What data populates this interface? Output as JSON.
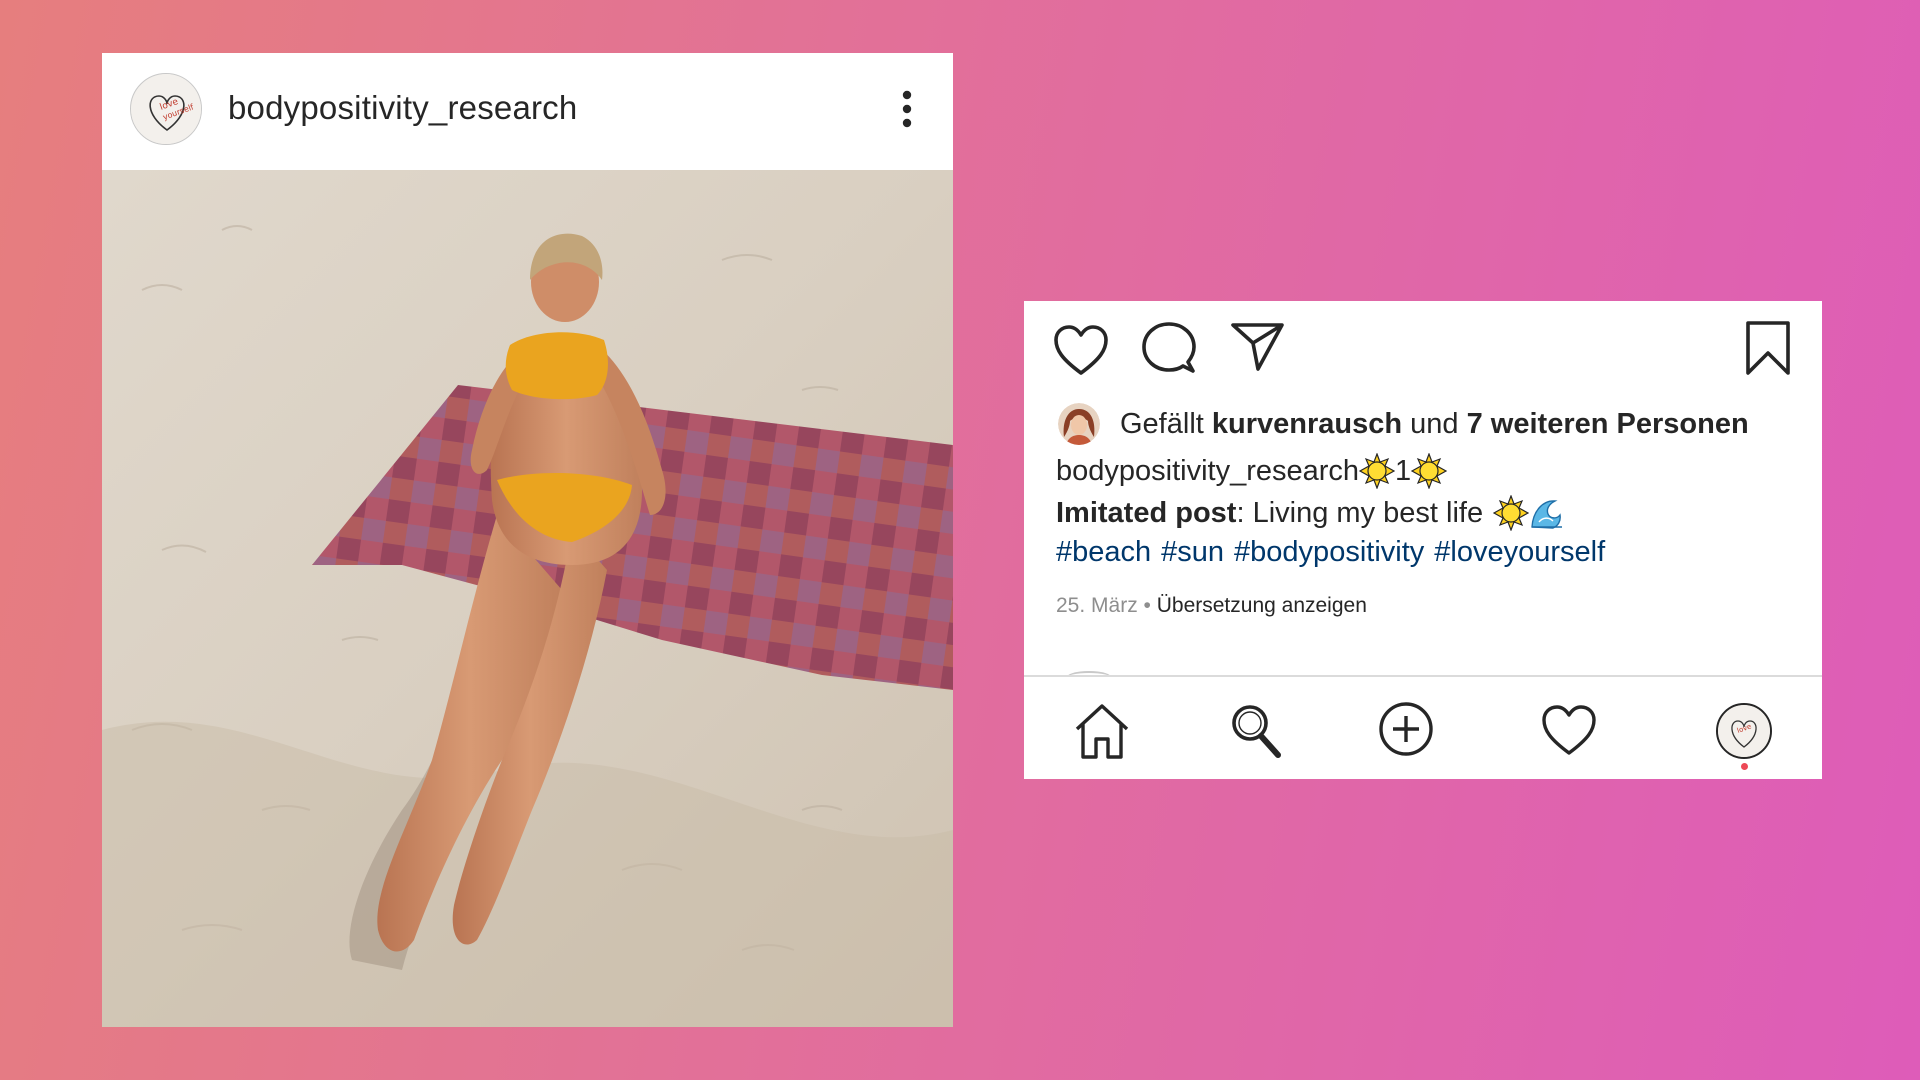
{
  "post": {
    "username": "bodypositivity_research",
    "avatar_icon": "love-yourself-logo",
    "menu_icon": "more-vertical-icon",
    "image_description_icon": "beach-photo"
  },
  "actions": {
    "like_icon": "heart-icon",
    "comment_icon": "comment-icon",
    "share_icon": "send-icon",
    "save_icon": "bookmark-icon"
  },
  "likes": {
    "prefix": "Gefällt",
    "liker": "kurvenrausch",
    "middle": "und",
    "others": "7 weiteren Personen"
  },
  "caption": {
    "username": "bodypositivity_research",
    "username_suffix_num": "1",
    "bold_label": "Imitated post",
    "text": ": Living my best life",
    "hashtags": [
      "#beach",
      "#sun",
      "#bodypositivity",
      "#loveyourself"
    ]
  },
  "meta": {
    "date": "25. März",
    "separator": " • ",
    "translate": "Übersetzung anzeigen"
  },
  "nav": {
    "items": [
      "home-icon",
      "search-icon",
      "add-icon",
      "activity-heart-icon",
      "profile-avatar"
    ]
  },
  "colors": {
    "hashtag": "#00376b",
    "text": "#262626",
    "muted": "#8e8e8e",
    "notification_dot": "#ed4956",
    "bg_left": "#e67e7e",
    "bg_right": "#de5cb9"
  }
}
